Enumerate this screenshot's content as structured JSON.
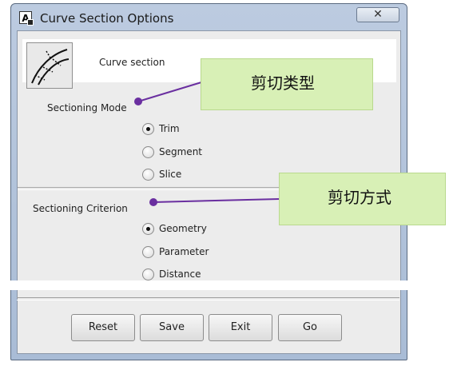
{
  "window": {
    "title": "Curve Section Options",
    "app_icon_letter": "A",
    "close_glyph": "✕"
  },
  "header": {
    "label": "Curve section",
    "icon": "curve-section-icon"
  },
  "sectioning_mode": {
    "label": "Sectioning Mode",
    "options": [
      {
        "label": "Trim",
        "selected": true
      },
      {
        "label": "Segment",
        "selected": false
      },
      {
        "label": "Slice",
        "selected": false
      }
    ]
  },
  "sectioning_criterion": {
    "label": "Sectioning Criterion",
    "options": [
      {
        "label": "Geometry",
        "selected": true
      },
      {
        "label": "Parameter",
        "selected": false
      },
      {
        "label": "Distance",
        "selected": false
      }
    ]
  },
  "buttons": {
    "reset": "Reset",
    "save": "Save",
    "exit": "Exit",
    "go": "Go"
  },
  "annotations": {
    "mode_callout": "剪切类型",
    "criterion_callout": "剪切方式",
    "pointer_color": "#6a2fa0",
    "callout_color": "#d8f0b6"
  }
}
